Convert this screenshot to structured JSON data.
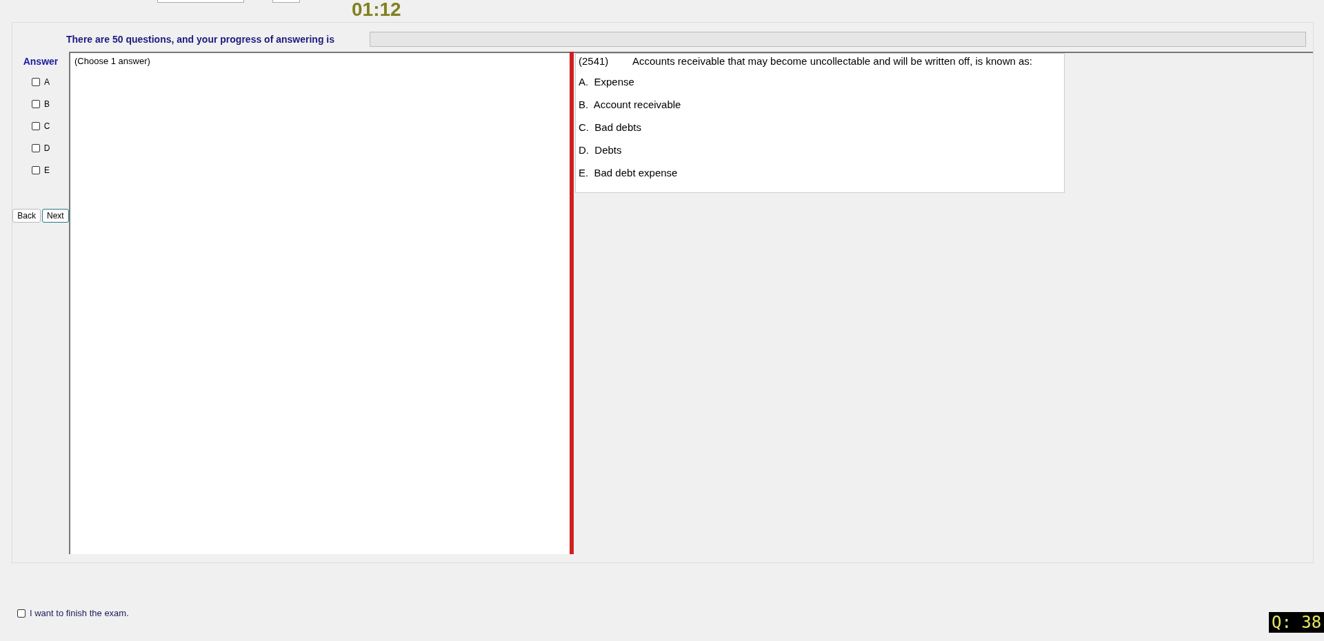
{
  "timer": "01:12",
  "progress": {
    "label": "There are 50 questions, and your progress of answering is",
    "level": 0
  },
  "answer_panel": {
    "title": "Answer",
    "options": [
      {
        "label": "A",
        "checked": false
      },
      {
        "label": "B",
        "checked": false
      },
      {
        "label": "C",
        "checked": false
      },
      {
        "label": "D",
        "checked": false
      },
      {
        "label": "E",
        "checked": false
      }
    ],
    "buttons": [
      "Back",
      "Next"
    ]
  },
  "answer_area": {
    "hint": "(Choose 1 answer)"
  },
  "question": {
    "number": "(2541)",
    "text": "Accounts receivable that may become uncollectable and will be written off, is known as:",
    "choices": [
      "A.  Expense",
      "B.  Account receivable",
      "C.  Bad debts",
      "D.  Debts",
      "E.  Bad debt expense"
    ]
  },
  "finish": {
    "label": "I want to finish the exam.",
    "checked": false
  },
  "question_counter": "Q: 38"
}
